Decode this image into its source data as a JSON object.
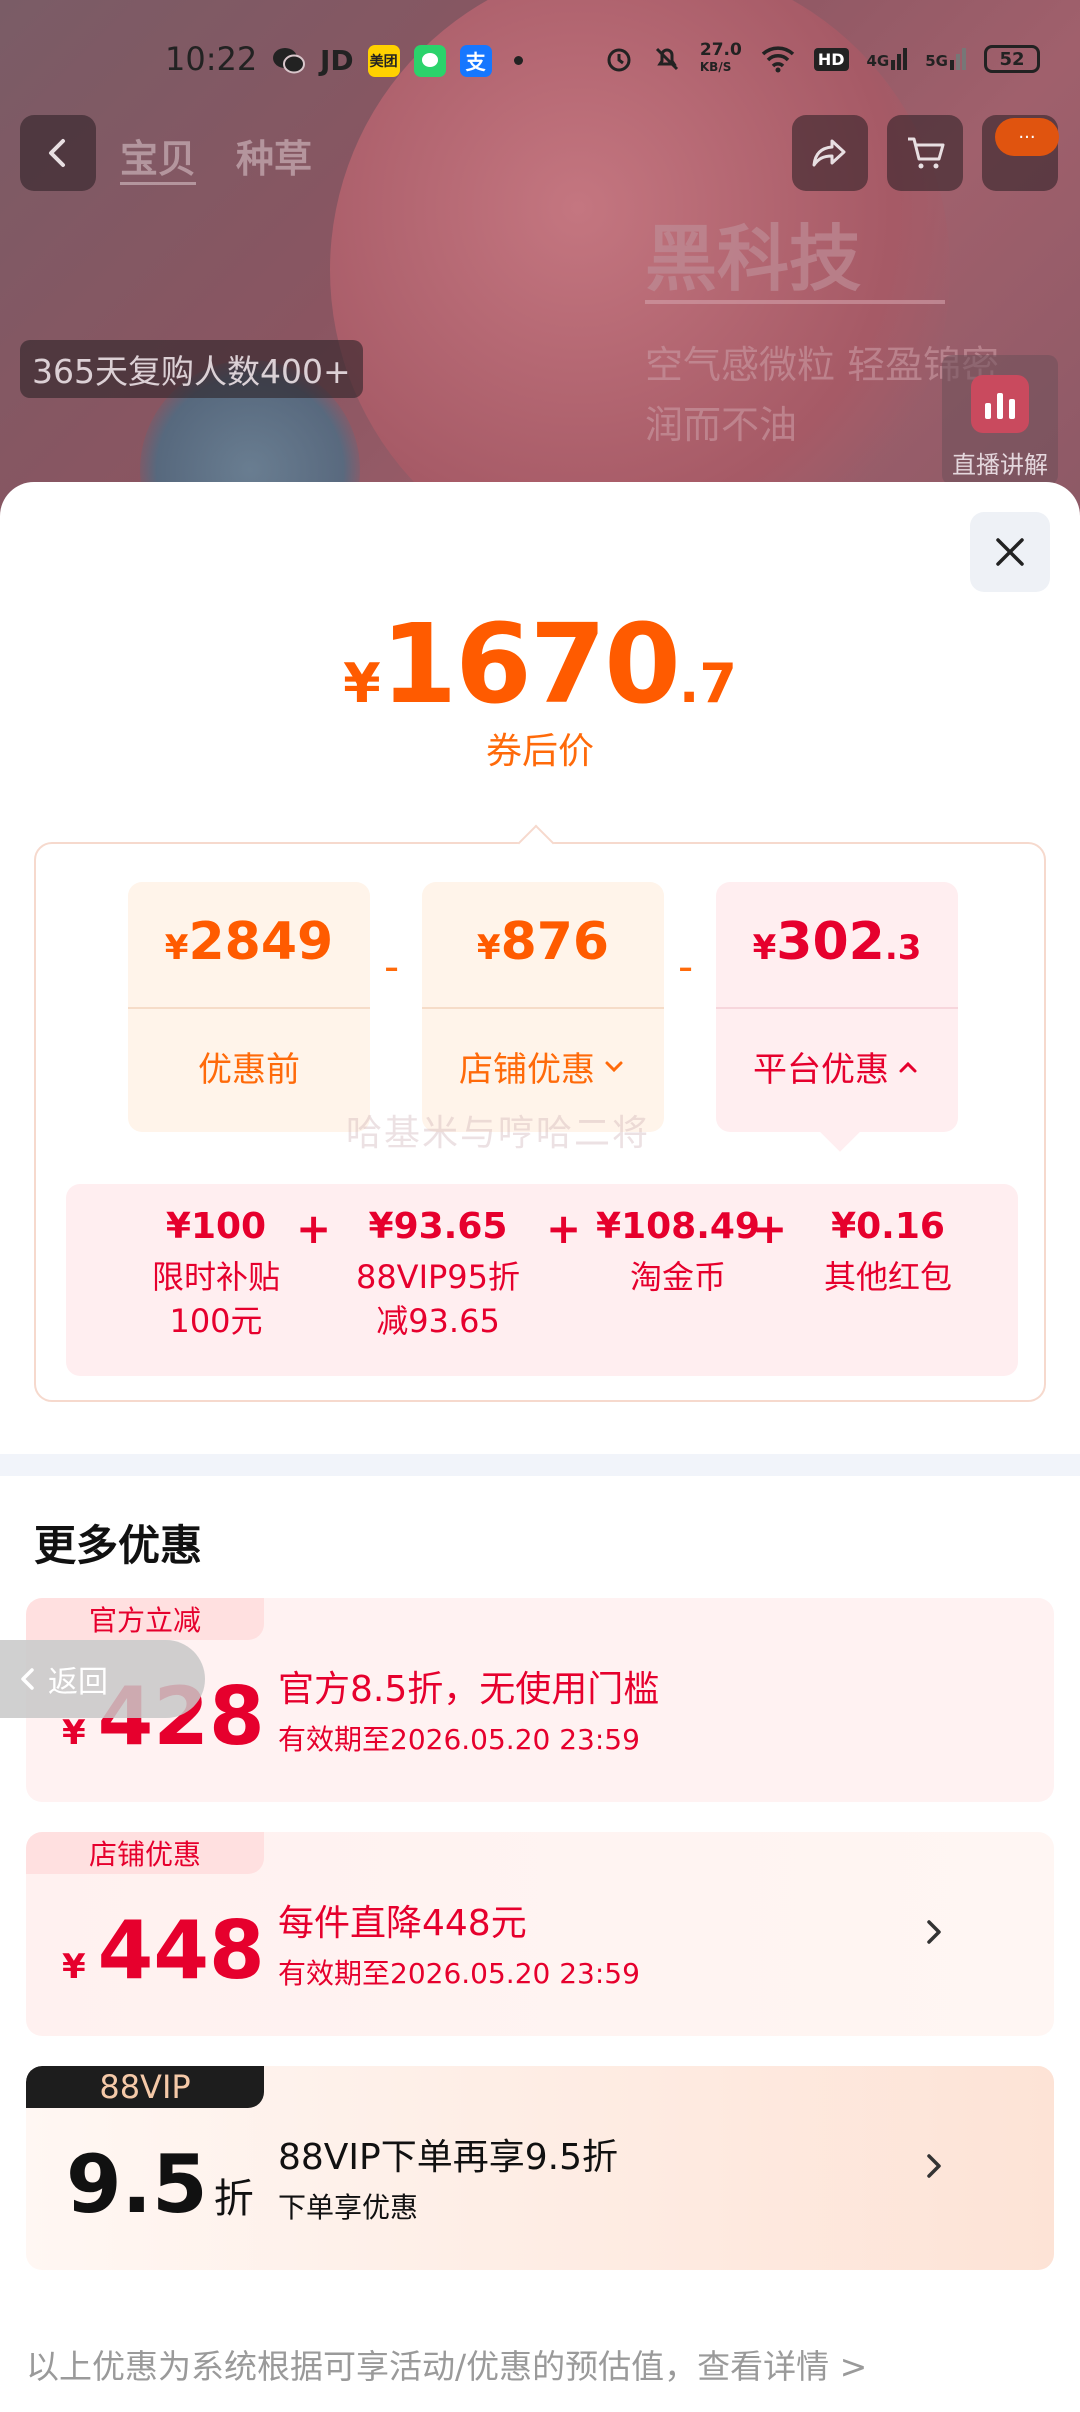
{
  "status_bar": {
    "time": "10:22",
    "app_icons": [
      "wechat-icon",
      "jd-icon",
      "meituan-icon",
      "message-icon",
      "alipay-icon"
    ],
    "jd_label": "JD",
    "meituan_label": "美团",
    "alipay_label": "支",
    "net_speed": "27.0",
    "net_unit": "KB/S",
    "hd_label": "HD",
    "sig1": "4G",
    "sig2": "5G",
    "battery": "52"
  },
  "product_header": {
    "tabs": [
      "宝贝",
      "种草"
    ],
    "repurchase_badge": "365天复购人数400+",
    "hero_title": "黑科技",
    "hero_sub1": "空气感微粒 轻盈锦密",
    "hero_sub2": "润而不油",
    "live_label": "直播讲解",
    "more_badge": "···"
  },
  "sheet": {
    "final_price": {
      "symbol": "¥",
      "integer": "1670",
      "decimal": ".7"
    },
    "final_price_label": "券后价",
    "breakdown": [
      {
        "symbol": "¥",
        "integer": "2849",
        "decimal": "",
        "label": "优惠前",
        "chevron": ""
      },
      {
        "symbol": "¥",
        "integer": "876",
        "decimal": "",
        "label": "店铺优惠",
        "chevron": "down"
      },
      {
        "symbol": "¥",
        "integer": "302",
        "decimal": ".3",
        "label": "平台优惠",
        "chevron": "up"
      }
    ],
    "operator": "-",
    "plus": "+",
    "platform_items": [
      {
        "value": "¥100",
        "desc_line1": "限时补贴",
        "desc_line2": "100元"
      },
      {
        "value": "¥93.65",
        "desc_line1": "88VIP95折",
        "desc_line2": "减93.65"
      },
      {
        "value": "¥108.49",
        "desc_line1": "淘金币",
        "desc_line2": ""
      },
      {
        "value": "¥0.16",
        "desc_line1": "其他红包",
        "desc_line2": ""
      }
    ],
    "watermark": "哈基米与哼哈二将",
    "more_title": "更多优惠",
    "offers": [
      {
        "tag": "官方立减",
        "symbol": "¥",
        "amount": "428",
        "unit": "",
        "title": "官方8.5折，无使用门槛",
        "subtitle": "有效期至2026.05.20 23:59",
        "has_chevron": false
      },
      {
        "tag": "店铺优惠",
        "symbol": "¥",
        "amount": "448",
        "unit": "",
        "title": "每件直降448元",
        "subtitle": "有效期至2026.05.20 23:59",
        "has_chevron": true
      },
      {
        "tag": "88VIP",
        "symbol": "",
        "amount": "9.5",
        "unit": "折",
        "title": "88VIP下单再享9.5折",
        "subtitle": "下单享优惠",
        "has_chevron": true
      }
    ],
    "back_label": "返回",
    "footer_note": "以上优惠为系统根据可享活动/优惠的预估值，查看详情 >"
  },
  "colors": {
    "accent_orange": "#ff5b00",
    "accent_red": "#e6002d",
    "vip_dark": "#1d1d1d"
  }
}
